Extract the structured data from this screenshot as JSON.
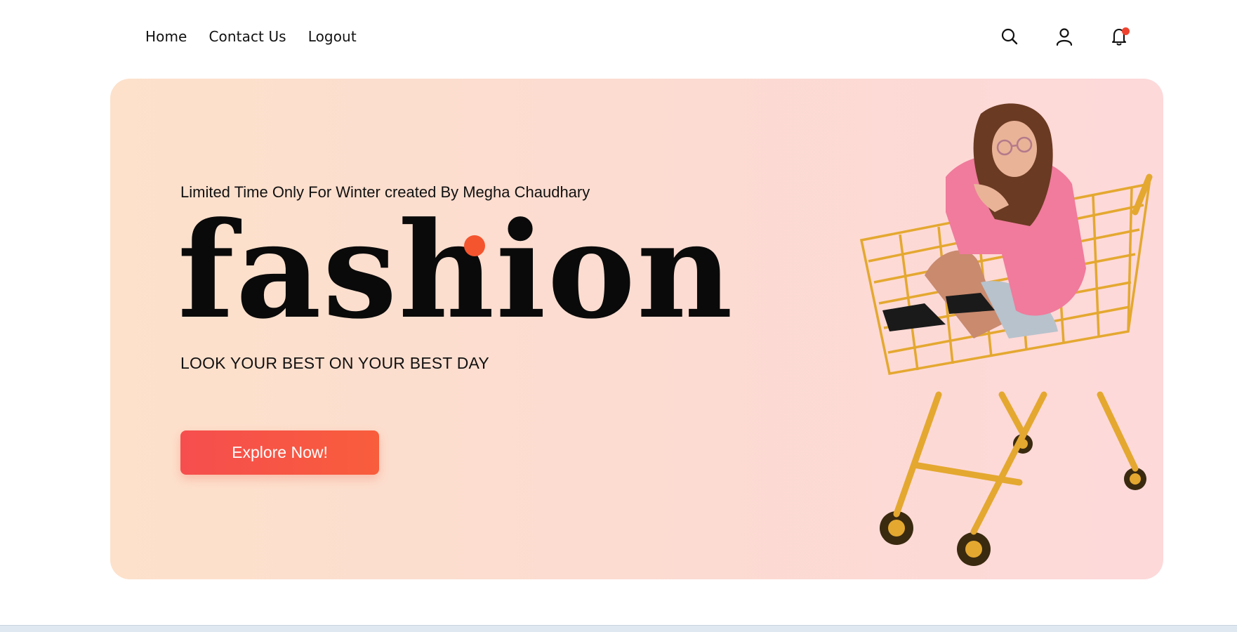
{
  "nav": {
    "links": [
      "Home",
      "Contact Us",
      "Logout"
    ],
    "icons": [
      "search-icon",
      "user-icon",
      "bell-icon"
    ]
  },
  "hero": {
    "subtitle": "Limited Time Only For Winter created By Megha Chaudhary",
    "title": "fashion",
    "tagline": "LOOK YOUR BEST ON YOUR BEST DAY",
    "cta_label": "Explore Now!"
  },
  "colors": {
    "accent": "#f4552f",
    "cta_start": "#f64e4e",
    "cta_end": "#f85d3c",
    "hero_bg_left": "#fde1cb",
    "hero_bg_right": "#fdd9da",
    "cart": "#e4a830",
    "shirt": "#f07b9c"
  }
}
